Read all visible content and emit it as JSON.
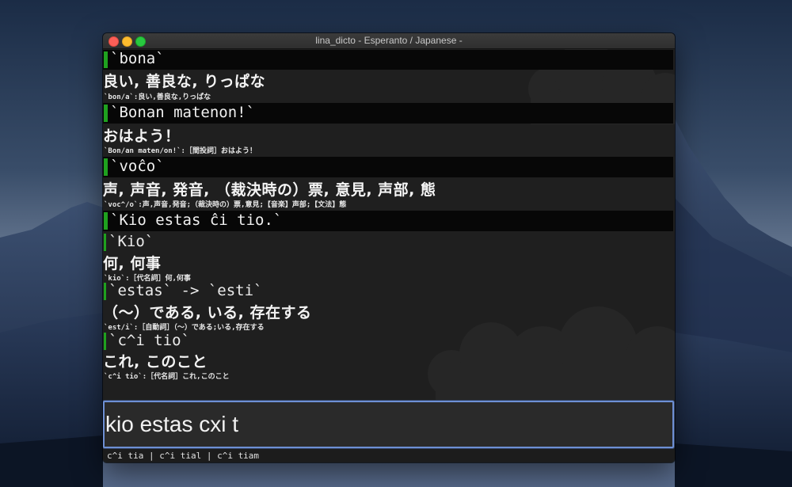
{
  "window": {
    "title": "lina_dicto - Esperanto / Japanese -"
  },
  "entries": [
    {
      "headword": "`bona`",
      "meaning": "良い, 善良な, りっぱな",
      "detail": "`bon/a`:良い,善良な,りっぱな"
    },
    {
      "headword": "`Bonan matenon!`",
      "meaning": "おはよう！",
      "detail": "`Bon/an maten/on!`:［間投詞］おはよう！"
    },
    {
      "headword": "`voĉo`",
      "meaning": "声, 声音, 発音, （裁決時の）票, 意見, 声部, 態",
      "detail": "`voc^/o`:声,声音,発音;（裁決時の）票,意見;【音楽】声部;【文法】態"
    },
    {
      "headword": "`Kio estas ĉi tio.`",
      "sub_entries": [
        {
          "headword": "`Kio`",
          "meaning": "何, 何事",
          "detail": "`kio`:［代名詞］何,何事"
        },
        {
          "headword": "`estas` -> `esti`",
          "meaning": "（〜）である, いる, 存在する",
          "detail": "`est/i`:［自動詞］（〜）である;いる,存在する"
        },
        {
          "headword": "`c^i tio`",
          "meaning": "これ, このこと",
          "detail": "`c^i tio`:［代名詞］これ,このこと"
        }
      ]
    }
  ],
  "input": {
    "value": "kio estas cxi t"
  },
  "suggestions": "c^i tia | c^i tial | c^i tiam",
  "colors": {
    "accent_green": "#1fa11f",
    "focus_ring": "#6d8fd4",
    "headword_bar": "#070707",
    "content_bg": "#1f1f1f"
  },
  "icons": [
    "close-dot-icon",
    "minimize-dot-icon",
    "maximize-dot-icon"
  ]
}
